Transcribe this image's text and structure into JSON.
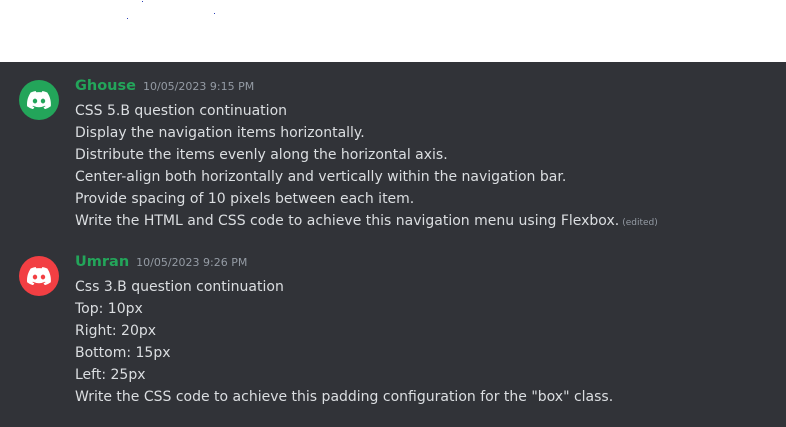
{
  "colors": {
    "chat_background": "#313338",
    "username_green": "#23a55a",
    "text": "#dbdee1",
    "muted": "#949ba4",
    "avatar_green": "#23a55a",
    "avatar_red": "#f23f43"
  },
  "messages": [
    {
      "author": "Ghouse",
      "timestamp": "10/05/2023 9:15 PM",
      "avatar_icon": "discord-logo-icon",
      "avatar_color": "#23a55a",
      "lines": [
        "CSS 5.B question continuation",
        "Display the navigation items horizontally.",
        "Distribute the items evenly along the horizontal axis.",
        "Center-align both horizontally and vertically within the navigation bar.",
        "Provide spacing of 10 pixels between each item.",
        "Write the HTML and CSS code to achieve this navigation menu using Flexbox."
      ],
      "edited_label": "(edited)"
    },
    {
      "author": "Umran",
      "timestamp": "10/05/2023 9:26 PM",
      "avatar_icon": "discord-logo-icon",
      "avatar_color": "#f23f43",
      "lines": [
        "Css 3.B question continuation",
        "Top: 10px",
        "Right: 20px",
        "Bottom: 15px",
        "Left: 25px",
        "Write the CSS code to achieve this padding configuration for the \"box\" class."
      ]
    }
  ]
}
